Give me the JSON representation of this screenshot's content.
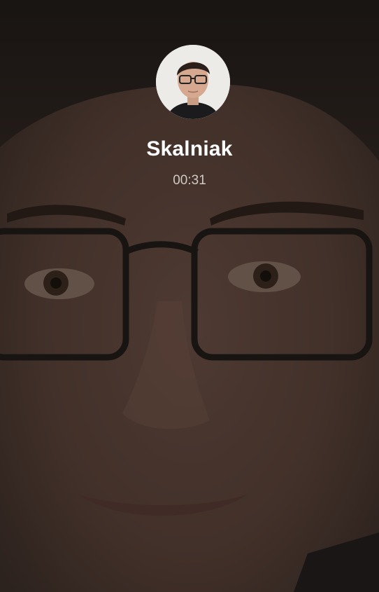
{
  "call": {
    "caller_name": "Skalniak",
    "duration": "00:31"
  },
  "icons": {
    "avatar": "contact-avatar-photo",
    "background": "caller-video-feed"
  },
  "colors": {
    "name_text": "#ffffff",
    "timer_text": "#cfcac6"
  }
}
